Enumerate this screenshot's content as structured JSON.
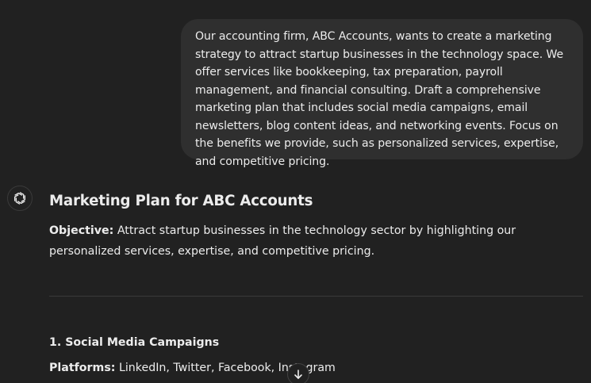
{
  "user_message": {
    "text": "Our accounting firm, ABC Accounts, wants to create a marketing strategy to attract startup businesses in the technology space. We offer services like bookkeeping, tax preparation, payroll management, and financial consulting. Draft a comprehensive marketing plan that includes social media campaigns, email newsletters, blog content ideas, and networking events. Focus on the benefits we provide, such as personalized services, expertise, and competitive pricing."
  },
  "assistant": {
    "avatar_icon": "openai-logo-icon",
    "title": "Marketing Plan for ABC Accounts",
    "objective_label": "Objective:",
    "objective_text": " Attract startup businesses in the technology sector by highlighting our personalized services, expertise, and competitive pricing.",
    "section_1_heading": "1. Social Media Campaigns",
    "platforms_label": "Platforms:",
    "platforms_text": " LinkedIn, Twitter, Facebook, Instagram"
  },
  "scroll_button": {
    "icon": "arrow-down-icon"
  },
  "colors": {
    "background": "#212121",
    "user_bubble": "#2f2f2f",
    "text": "#ececec"
  }
}
